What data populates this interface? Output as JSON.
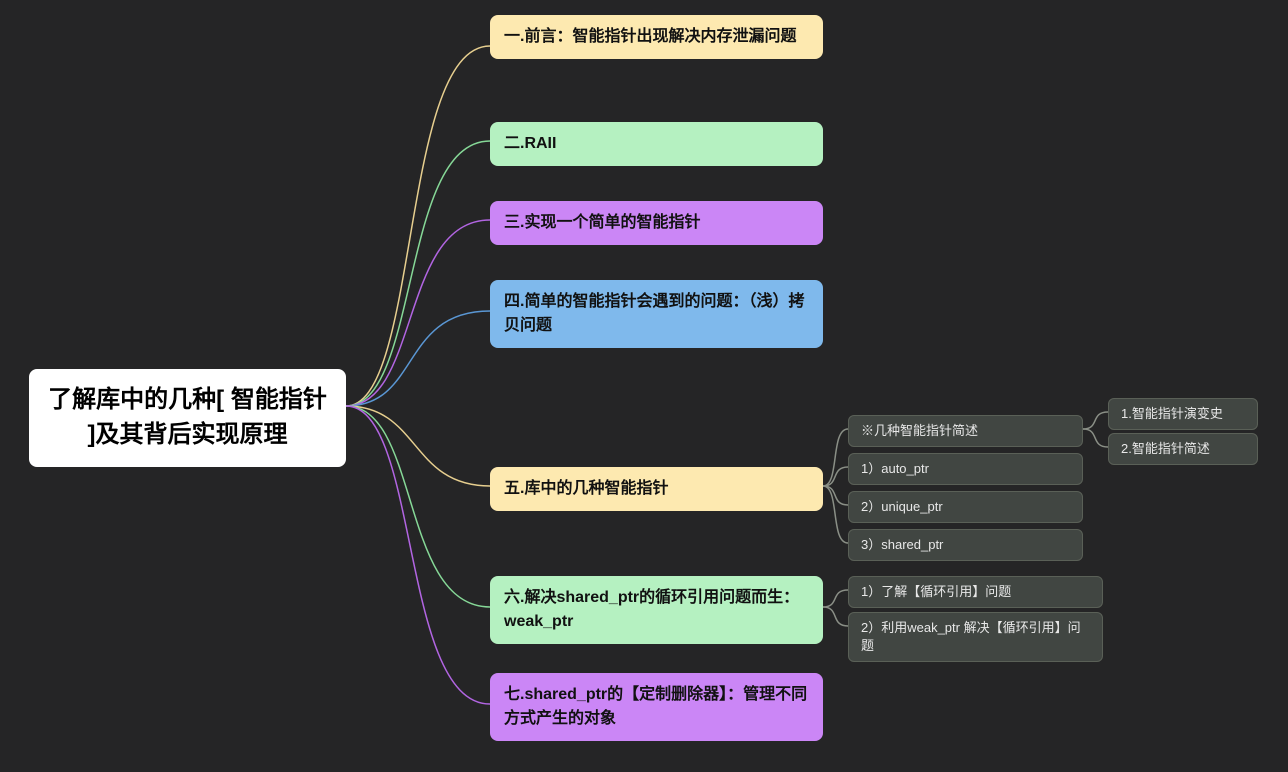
{
  "root": {
    "title": "了解库中的几种[ 智能指针 ]及其背后实现原理"
  },
  "nodes": {
    "n1": "一.前言：智能指针出现解决内存泄漏问题",
    "n2": "二.RAII",
    "n3": "三.实现一个简单的智能指针",
    "n4": "四.简单的智能指针会遇到的问题：（浅）拷贝问题",
    "n5": "五.库中的几种智能指针",
    "n6": "六.解决shared_ptr的循环引用问题而生：weak_ptr",
    "n7": "七.shared_ptr的【定制删除器】：管理不同方式产生的对象"
  },
  "sub5": {
    "s1": "※几种智能指针简述",
    "s2": "1）auto_ptr",
    "s3": "2）unique_ptr",
    "s4": "3）shared_ptr"
  },
  "sub5_1": {
    "a": "1.智能指针演变史",
    "b": "2.智能指针简述"
  },
  "sub6": {
    "a": "1）了解【循环引用】问题",
    "b": "2）利用weak_ptr 解决【循环引用】问题"
  },
  "colors": {
    "yellow": "#e7cf8f",
    "green": "#86d897",
    "purple": "#b265e2",
    "blue": "#5a97d4",
    "gray": "#8a8f86"
  }
}
